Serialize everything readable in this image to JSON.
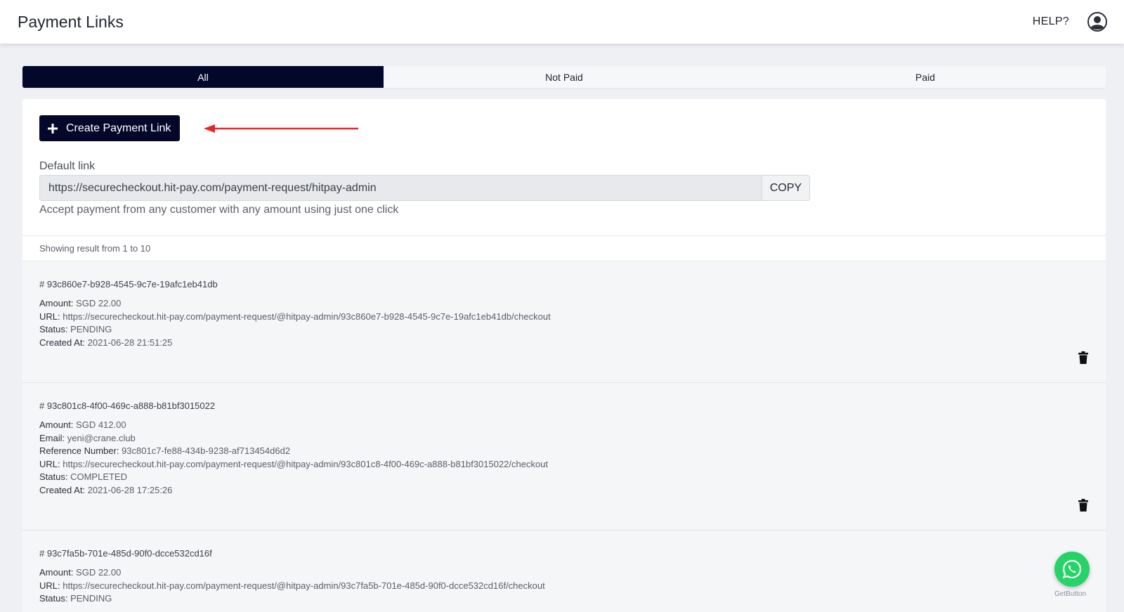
{
  "header": {
    "title": "Payment Links",
    "help_label": "HELP?"
  },
  "tabs": [
    {
      "label": "All",
      "active": true
    },
    {
      "label": "Not Paid",
      "active": false
    },
    {
      "label": "Paid",
      "active": false
    }
  ],
  "create_button_label": "Create Payment Link",
  "default_link": {
    "label": "Default link",
    "value": "https://securecheckout.hit-pay.com/payment-request/hitpay-admin",
    "copy_label": "COPY",
    "help_text": "Accept payment from any customer with any amount using just one click"
  },
  "results_summary": "Showing result from 1 to 10",
  "payments": [
    {
      "id": "# 93c860e7-b928-4545-9c7e-19afc1eb41db",
      "amount_label": "Amount:",
      "amount": "SGD 22.00",
      "url_label": "URL:",
      "url": "https://securecheckout.hit-pay.com/payment-request/@hitpay-admin/93c860e7-b928-4545-9c7e-19afc1eb41db/checkout",
      "status_label": "Status:",
      "status": "PENDING",
      "created_label": "Created At:",
      "created": "2021-06-28 21:51:25"
    },
    {
      "id": "# 93c801c8-4f00-469c-a888-b81bf3015022",
      "amount_label": "Amount:",
      "amount": "SGD 412.00",
      "email_label": "Email:",
      "email": "yeni@crane.club",
      "reference_label": "Reference Number:",
      "reference": "93c801c7-fe88-434b-9238-af713454d6d2",
      "url_label": "URL:",
      "url": "https://securecheckout.hit-pay.com/payment-request/@hitpay-admin/93c801c8-4f00-469c-a888-b81bf3015022/checkout",
      "status_label": "Status:",
      "status": "COMPLETED",
      "created_label": "Created At:",
      "created": "2021-06-28 17:25:26"
    },
    {
      "id": "# 93c7fa5b-701e-485d-90f0-dcce532cd16f",
      "amount_label": "Amount:",
      "amount": "SGD 22.00",
      "url_label": "URL:",
      "url": "https://securecheckout.hit-pay.com/payment-request/@hitpay-admin/93c7fa5b-701e-485d-90f0-dcce532cd16f/checkout",
      "status_label": "Status:",
      "status": "PENDING"
    }
  ],
  "widget": {
    "icon": "whatsapp-icon",
    "caption": "GetButton"
  },
  "colors": {
    "primary": "#03082b",
    "annotation_arrow": "#e8262a",
    "whatsapp": "#25d366"
  }
}
